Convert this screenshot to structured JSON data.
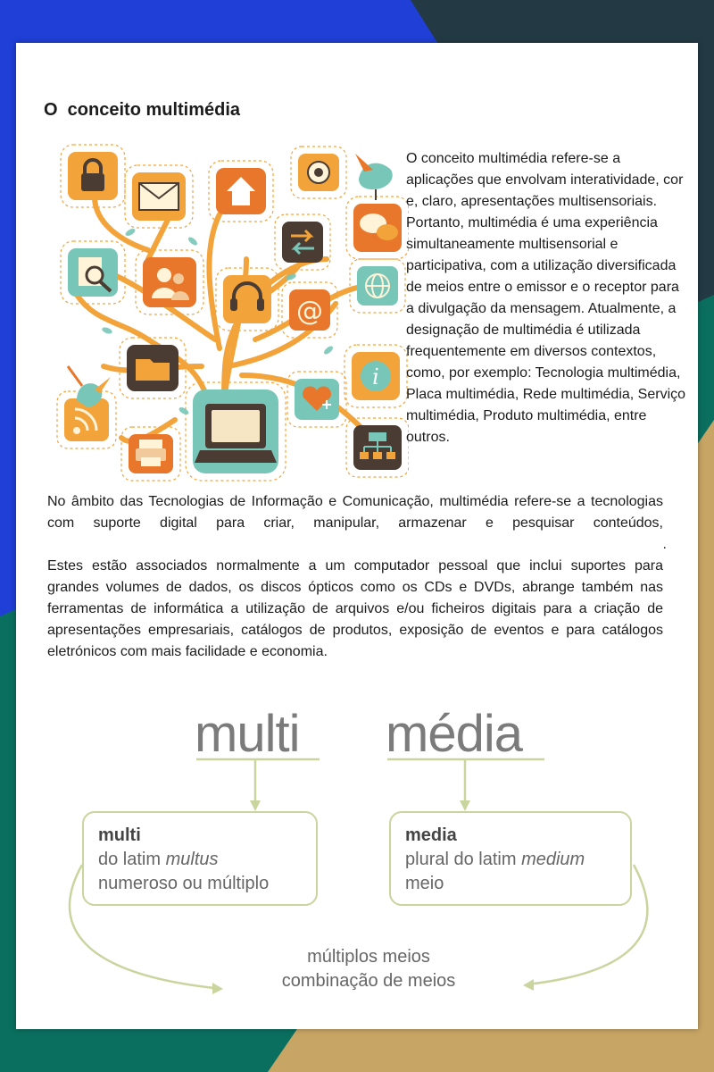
{
  "document": {
    "title": "O  conceito multimédia",
    "intro": "O conceito multimédia refere-se a aplicações que envolvam interatividade, cor e, claro, apresentações multisensoriais. Portanto, multimédia é uma experiência simultaneamente multisensorial e participativa, com a utilização diversificada de meios entre o emissor e o receptor para a divulgação da mensagem. Atualmente, a designação de multimédia é utilizada frequentemente em diversos contextos, como, por exemplo: Tecnologia multimédia, Placa multimédia, Rede multimédia, Serviço multimédia, Produto multimédia, entre outros.",
    "paragraph1": "No âmbito das Tecnologias de Informação e Comunicação, multimédia refere-se a tecnologias com suporte digital para criar, manipular, armazenar e pesquisar conteúdos,",
    "paragraph1_end": ".",
    "paragraph2": "Estes estão associados normalmente a um computador pessoal que inclui suportes para grandes volumes de dados, os discos ópticos como os CDs e DVDs, abrange também nas ferramentas de informática a utilização de arquivos e/ou ficheiros digitais para a criação de apresentações empresariais, catálogos de produtos, exposição de eventos e para catálogos eletrónicos com mais facilidade e economia."
  },
  "diagram": {
    "word_left": "multi",
    "word_right": "média",
    "left_box": {
      "head": "multi",
      "line1_prefix": "do latim ",
      "line1_italic": "multus",
      "line2": "numeroso ou múltiplo"
    },
    "right_box": {
      "head": "media",
      "line1_prefix": "plural do latim ",
      "line1_italic": "medium",
      "line2": "meio"
    },
    "result_line1": "múltiplos meios",
    "result_line2": "combinação de meios"
  },
  "colors": {
    "orange": "#f2a33a",
    "dark_orange": "#e8762b",
    "teal": "#78c6b8",
    "brown": "#4a3b33",
    "diagram_green": "#c9d49e",
    "bg_blue": "#1f3fd6",
    "bg_teal": "#0b6f5f",
    "bg_gold": "#c7a565",
    "bg_slate": "#233a45"
  },
  "icons": [
    "lock-icon",
    "mail-icon",
    "home-icon",
    "webcam-icon",
    "bird-icon",
    "chat-icon",
    "search-document-icon",
    "users-icon",
    "headset-icon",
    "arrows-icon",
    "globe-icon",
    "at-sign-icon",
    "folder-icon",
    "info-icon",
    "rss-icon",
    "laptop-icon",
    "heart-plus-icon",
    "printer-icon",
    "network-icon"
  ]
}
